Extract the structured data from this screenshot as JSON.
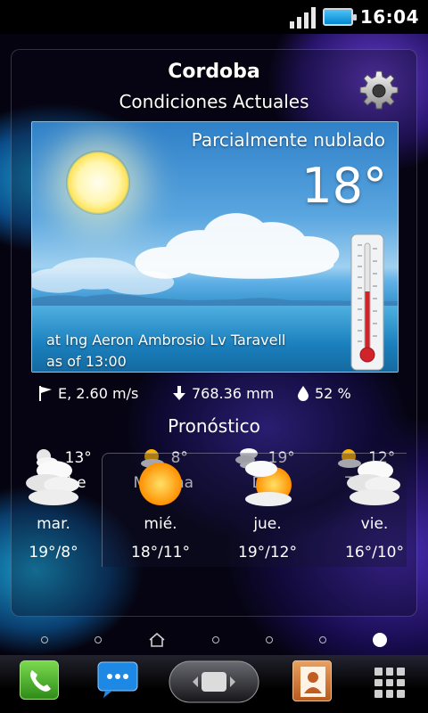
{
  "status_bar": {
    "time": "16:04",
    "icons": [
      "signal-icon",
      "battery-icon"
    ],
    "battery_color": "#29a6e8"
  },
  "widget": {
    "location": "Cordoba",
    "subtitle": "Condiciones Actuales",
    "settings_icon": "gear-icon",
    "current": {
      "condition": "Parcialmente nublado",
      "temperature": "18°",
      "station": "at Ing Aeron Ambrosio Lv Taravell",
      "observed": "as of 13:00",
      "wind": "E, 2.60 m/s",
      "pressure": "768.36 mm",
      "humidity": "52 %",
      "stat_icons": [
        "flag-icon",
        "arrow-down-icon",
        "drop-icon"
      ]
    },
    "forecast_title": "Pronóstico",
    "periods": [
      {
        "temp": "13°",
        "name": "Noche",
        "icon": "moon-cloud-icon"
      },
      {
        "temp": "8°",
        "name": "Mañana",
        "icon": "sun-cloud-icon"
      },
      {
        "temp": "19°",
        "name": "Día",
        "icon": "cloud-icon"
      },
      {
        "temp": "12°",
        "name": "Tarde",
        "icon": "sun-cloud-icon"
      }
    ],
    "days": [
      {
        "name": "mar.",
        "range": "19°/8°",
        "icon": "cloud-icon"
      },
      {
        "name": "mié.",
        "range": "18°/11°",
        "icon": "sun-icon"
      },
      {
        "name": "jue.",
        "range": "19°/12°",
        "icon": "sun-cloud-icon"
      },
      {
        "name": "vie.",
        "range": "16°/10°",
        "icon": "cloud-icon"
      }
    ]
  },
  "pager": {
    "pages": 7,
    "active_page": 7,
    "home_page": 3
  },
  "dock": {
    "items": [
      "phone-icon",
      "messaging-icon",
      "app-drawer-icon",
      "contacts-icon",
      "apps-grid-icon"
    ]
  }
}
